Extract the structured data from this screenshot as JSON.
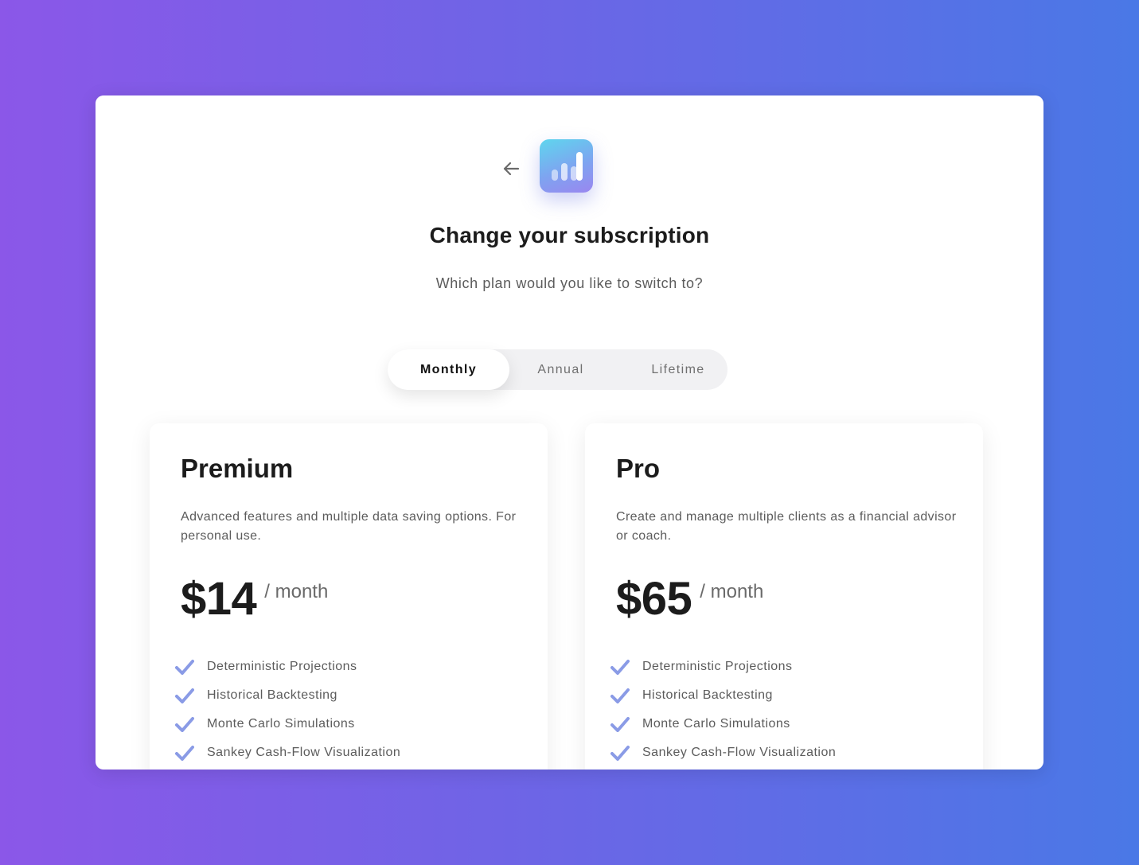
{
  "header": {
    "title": "Change your subscription",
    "subtitle": "Which plan would you like to switch to?"
  },
  "icons": {
    "back": "arrow-left-icon",
    "logo": "bar-chart-logo-icon",
    "check": "check-icon"
  },
  "colors": {
    "accent_check": "#8a9be6",
    "logo_gradient_start": "#5ed6ee",
    "logo_gradient_end": "#9a86f0"
  },
  "billing_toggle": {
    "selected": "Monthly",
    "options": [
      {
        "label": "Monthly"
      },
      {
        "label": "Annual"
      },
      {
        "label": "Lifetime"
      }
    ]
  },
  "plans": [
    {
      "name": "Premium",
      "description": "Advanced features and multiple data saving options. For personal use.",
      "price": "$14",
      "period": "/ month",
      "features": [
        "Deterministic Projections",
        "Historical Backtesting",
        "Monte Carlo Simulations",
        "Sankey Cash-Flow Visualization"
      ]
    },
    {
      "name": "Pro",
      "description": "Create and manage multiple clients as a financial advisor or coach.",
      "price": "$65",
      "period": "/ month",
      "features": [
        "Deterministic Projections",
        "Historical Backtesting",
        "Monte Carlo Simulations",
        "Sankey Cash-Flow Visualization"
      ]
    }
  ]
}
